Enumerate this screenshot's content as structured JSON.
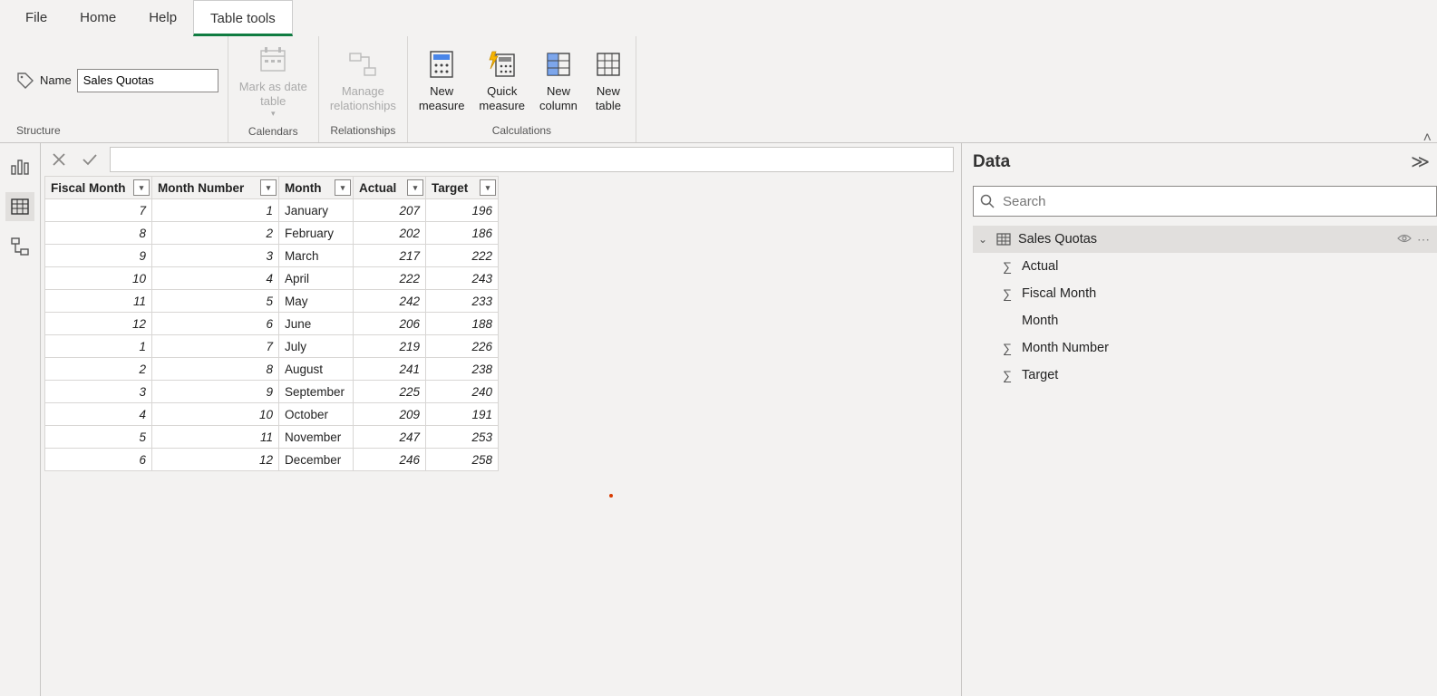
{
  "menu": {
    "file": "File",
    "home": "Home",
    "help": "Help",
    "tabletools": "Table tools"
  },
  "ribbon": {
    "name_label": "Name",
    "name_value": "Sales Quotas",
    "groups": {
      "structure": "Structure",
      "calendars": "Calendars",
      "relationships": "Relationships",
      "calculations": "Calculations"
    },
    "buttons": {
      "mark_date": "Mark as date\ntable",
      "manage_rel": "Manage\nrelationships",
      "new_measure": "New\nmeasure",
      "quick_measure": "Quick\nmeasure",
      "new_column": "New\ncolumn",
      "new_table": "New\ntable"
    }
  },
  "table": {
    "headers": {
      "fiscal": "Fiscal Month",
      "monthnum": "Month Number",
      "month": "Month",
      "actual": "Actual",
      "target": "Target"
    },
    "rows": [
      {
        "fiscal": "7",
        "monthnum": "1",
        "month": "January",
        "actual": "207",
        "target": "196"
      },
      {
        "fiscal": "8",
        "monthnum": "2",
        "month": "February",
        "actual": "202",
        "target": "186"
      },
      {
        "fiscal": "9",
        "monthnum": "3",
        "month": "March",
        "actual": "217",
        "target": "222"
      },
      {
        "fiscal": "10",
        "monthnum": "4",
        "month": "April",
        "actual": "222",
        "target": "243"
      },
      {
        "fiscal": "11",
        "monthnum": "5",
        "month": "May",
        "actual": "242",
        "target": "233"
      },
      {
        "fiscal": "12",
        "monthnum": "6",
        "month": "June",
        "actual": "206",
        "target": "188"
      },
      {
        "fiscal": "1",
        "monthnum": "7",
        "month": "July",
        "actual": "219",
        "target": "226"
      },
      {
        "fiscal": "2",
        "monthnum": "8",
        "month": "August",
        "actual": "241",
        "target": "238"
      },
      {
        "fiscal": "3",
        "monthnum": "9",
        "month": "September",
        "actual": "225",
        "target": "240"
      },
      {
        "fiscal": "4",
        "monthnum": "10",
        "month": "October",
        "actual": "209",
        "target": "191"
      },
      {
        "fiscal": "5",
        "monthnum": "11",
        "month": "November",
        "actual": "247",
        "target": "253"
      },
      {
        "fiscal": "6",
        "monthnum": "12",
        "month": "December",
        "actual": "246",
        "target": "258"
      }
    ]
  },
  "datapane": {
    "title": "Data",
    "search_placeholder": "Search",
    "table_name": "Sales Quotas",
    "fields": [
      {
        "name": "Actual",
        "sigma": true
      },
      {
        "name": "Fiscal Month",
        "sigma": true
      },
      {
        "name": "Month",
        "sigma": false
      },
      {
        "name": "Month Number",
        "sigma": true
      },
      {
        "name": "Target",
        "sigma": true
      }
    ]
  }
}
